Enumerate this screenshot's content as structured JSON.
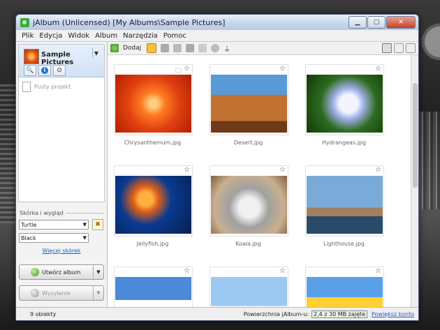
{
  "window": {
    "title": "jAlbum (Unlicensed) [My Albums\\Sample Pictures]"
  },
  "menu": [
    "Plik",
    "Edycja",
    "Widok",
    "Album",
    "Narzędzia",
    "Pomoc"
  ],
  "album": {
    "name": "Sample Pictures",
    "project_label": "Pusty projekt"
  },
  "toolbar": {
    "add_label": "Dodaj"
  },
  "skin": {
    "section_title": "Skórka i wygląd",
    "skin_value": "Turtle",
    "style_value": "Black",
    "more_skins_link": "Więcej skórek"
  },
  "actions": {
    "create_album": "Utwórz album",
    "upload": "Wysyłanie"
  },
  "gallery": {
    "items": [
      {
        "name": "Chrysanthemum.jpg",
        "theme": "flower",
        "has_folder_icon": true
      },
      {
        "name": "Desert.jpg",
        "theme": "desert"
      },
      {
        "name": "Hydrangeas.jpg",
        "theme": "hydrangea"
      },
      {
        "name": "Jellyfish.jpg",
        "theme": "jellyfish"
      },
      {
        "name": "Koala.jpg",
        "theme": "koala"
      },
      {
        "name": "Lighthouse.jpg",
        "theme": "lighthouse"
      },
      {
        "name": "",
        "theme": "sky"
      },
      {
        "name": "",
        "theme": "penguins"
      },
      {
        "name": "",
        "theme": "tulips"
      }
    ]
  },
  "status": {
    "count": "9 obiekty",
    "space_label": "Powierzchnia jAlbum-u:",
    "space_value": "2,4 z 30 MB zajęte",
    "upgrade_link": "Powiększ konto"
  },
  "colors": {
    "accent": "#1e6fd0",
    "link": "#2060c0",
    "create_button_orb": "#3c9a1a"
  },
  "icons": [
    "add-icon",
    "star-icon",
    "folder-icon",
    "info-icon",
    "search-icon",
    "filter-icon",
    "grid-view-icon",
    "edit-view-icon",
    "preview-icon"
  ]
}
